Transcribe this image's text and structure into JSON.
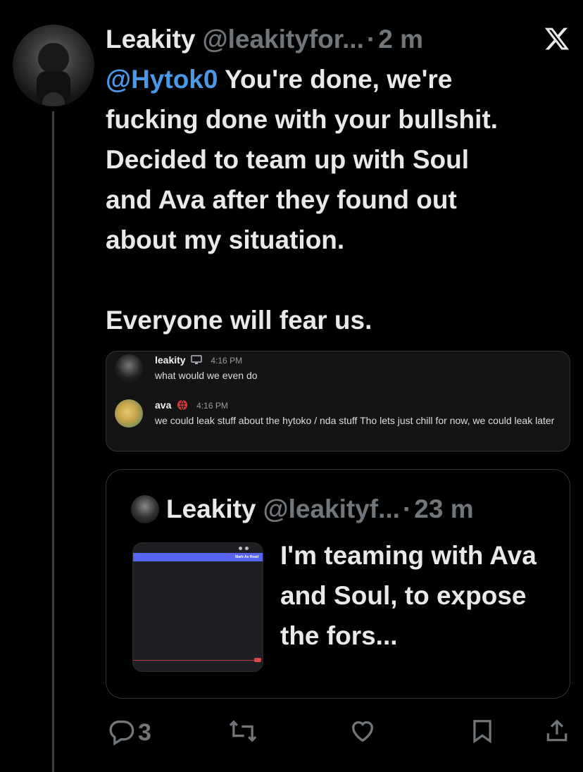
{
  "tweet": {
    "author_name": "Leakity",
    "author_handle": "@leakityfor...",
    "separator": "·",
    "time": "2 m",
    "mention": "@Hytok0",
    "body_line1": " You're done, we're",
    "body_line2": "fucking done with your bullshit.",
    "body_line3": "Decided to team up with Soul",
    "body_line4": "and Ava after they found out",
    "body_line5": "about my situation.",
    "body_line6": "Everyone will fear us."
  },
  "discord": {
    "messages": [
      {
        "name": "leakity",
        "time": "4:16 PM",
        "text": "what would we even do"
      },
      {
        "name": "ava",
        "time": "4:16 PM",
        "text": "we could leak stuff about the hytoko / nda stuff Tho lets just chill for now, we could leak later"
      }
    ]
  },
  "quote": {
    "author_name": "Leakity",
    "author_handle": "@leakityf...",
    "separator": "·",
    "time": "23 m",
    "text": "I'm teaming with Ava and Soul, to expose the fors...",
    "image_label": "Mark As Read"
  },
  "actions": {
    "reply_count": "3",
    "icons": [
      "reply-icon",
      "retweet-icon",
      "like-icon",
      "bookmark-icon",
      "share-icon"
    ]
  },
  "colors": {
    "background": "#000000",
    "text": "#e7e9ea",
    "muted": "#71767b",
    "link": "#4a99e9",
    "discord_bg": "#141414",
    "discord_accent": "#5865f2"
  }
}
